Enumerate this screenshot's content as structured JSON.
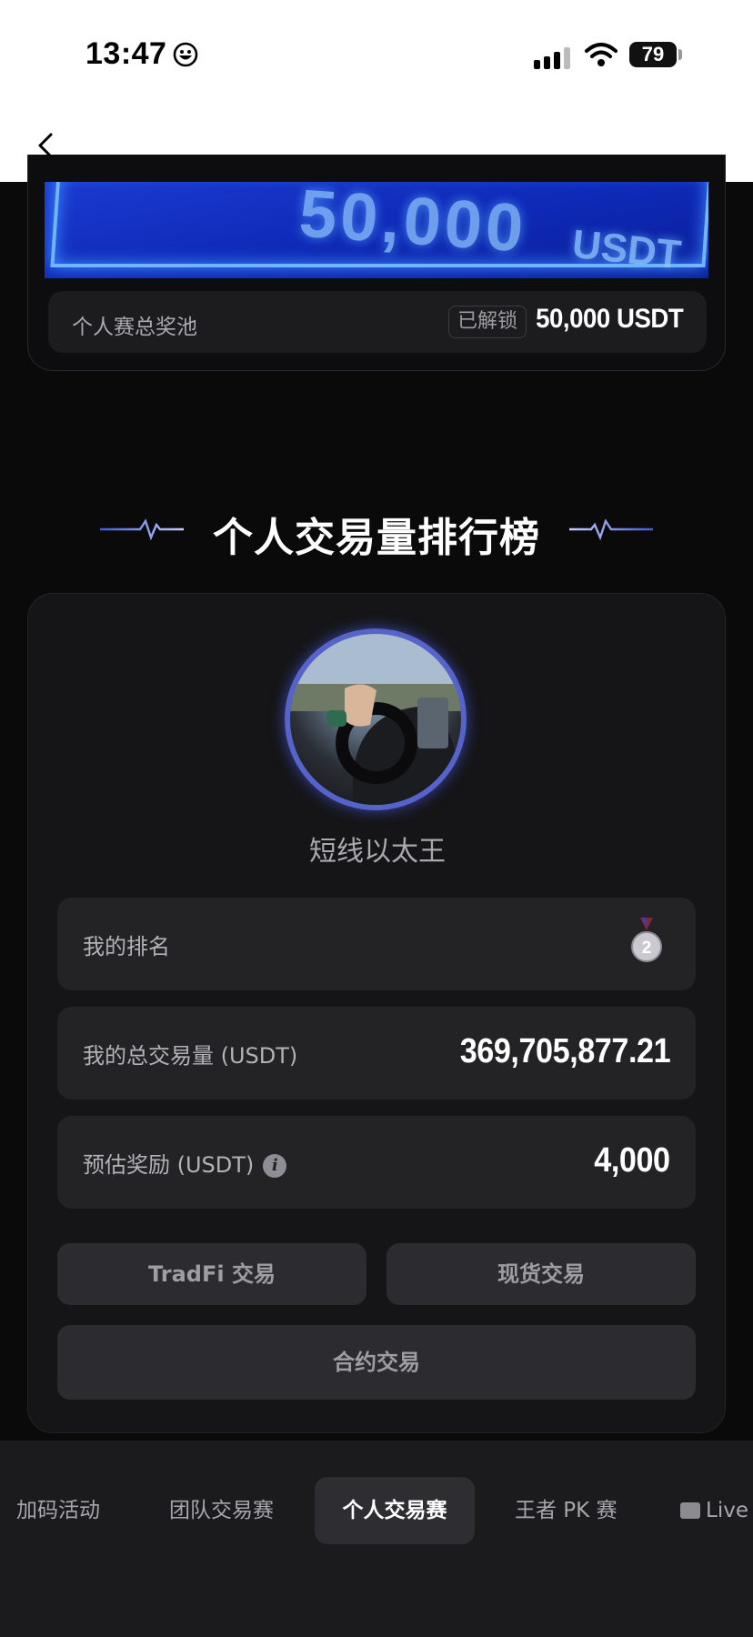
{
  "status_bar": {
    "time": "13:47",
    "battery": "79"
  },
  "prize": {
    "banner_amount": "50,000",
    "banner_unit": "USDT",
    "pool_label": "个人赛总奖池",
    "pool_badge": "已解锁",
    "pool_value": "50,000 USDT"
  },
  "leaderboard": {
    "title": "个人交易量排行榜"
  },
  "profile": {
    "username": "短线以太王",
    "rank_label": "我的排名",
    "rank_value": 2,
    "volume_label": "我的总交易量 (USDT)",
    "volume_value": "369,705,877.21",
    "reward_label": "预估奖励 (USDT)",
    "reward_value": "4,000"
  },
  "buttons": {
    "tradfi": "TradFi 交易",
    "spot": "现货交易",
    "futures": "合约交易"
  },
  "tabs": [
    {
      "label": "加码活动"
    },
    {
      "label": "团队交易赛"
    },
    {
      "label": "个人交易赛"
    },
    {
      "label": "王者 PK 赛"
    },
    {
      "label": "Live"
    }
  ],
  "colors": {
    "background": "#0a0a0b",
    "card": "#151517",
    "accent_avatar_ring": "#5564c9",
    "banner_blue": "#1b3bd0"
  }
}
